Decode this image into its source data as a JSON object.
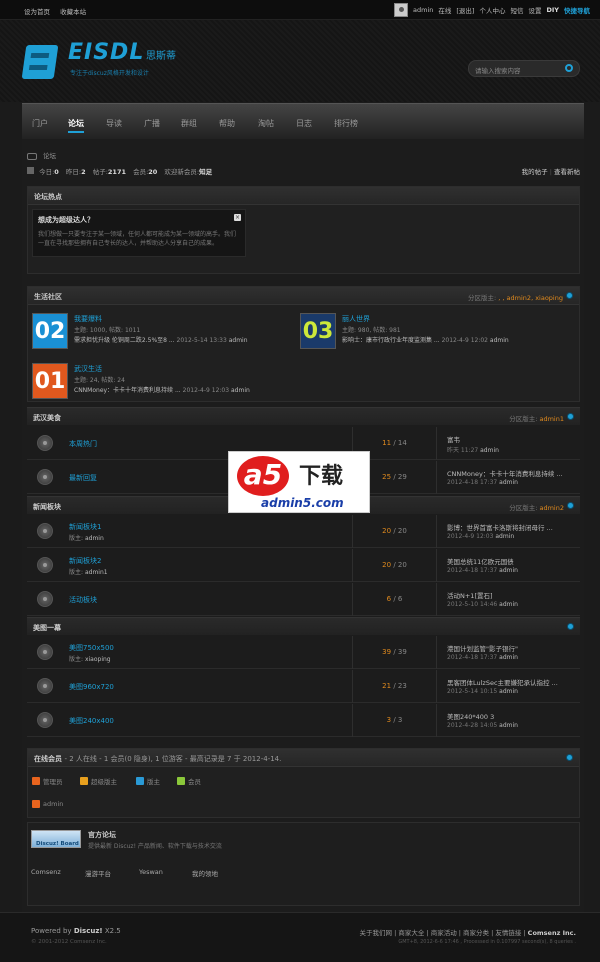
{
  "topbar": {
    "set_home": "设为首页",
    "favorite": "收藏本站",
    "username": "admin",
    "online": "在线",
    "logout": "[退出]",
    "personal": "个人中心",
    "messages": "短信",
    "settings": "设置",
    "diy": "DIY",
    "quick_nav": "快捷导航"
  },
  "header": {
    "logo_text": "EISDL",
    "logo_cn": "思斯蒂",
    "logo_sub": "专注于discuz风格开发和设计",
    "search_placeholder": "请输入搜索内容"
  },
  "nav": {
    "items": [
      "门户",
      "论坛",
      "导读",
      "广播",
      "群组",
      "帮助",
      "淘帖",
      "日志",
      "排行榜"
    ],
    "active": "论坛"
  },
  "breadcrumb": {
    "label": "论坛"
  },
  "stats": {
    "today_label": "今日:",
    "today": "0",
    "yesterday_label": "昨日:",
    "yesterday": "2",
    "posts_label": "帖子:",
    "posts": "2171",
    "members_label": "会员:",
    "members": "20",
    "newest_label": "欢迎新会员:",
    "newest": "知足",
    "my_posts": "我的帖子",
    "view_new": "查看新帖"
  },
  "hot": {
    "title": "论坛热点",
    "card_title": "想成为超级达人？",
    "card_text": "我们想做一只要专注于某一领域，任何人都可能成为某一领域的高手。我们一直在寻找那些拥有自己专长的达人，并帮助达人分享自己的成果。"
  },
  "life": {
    "title": "生活社区",
    "mod_label": "分区版主:",
    "mods": ", , admin2, xiaoping",
    "forums": [
      {
        "tile": "02",
        "name": "我要爆料",
        "meta": "主题: 1000, 帖数: 1011",
        "last": "需求担忧升级 伦铜周二跌2.5%至8 ...",
        "date": "2012-5-14 13:33",
        "user": "admin"
      },
      {
        "tile": "03",
        "name": "丽人世界",
        "meta": "主题: 980, 帖数: 981",
        "last": "影响士：康市行政行业年度监测集 ...",
        "date": "2012-4-9 12:02",
        "user": "admin"
      },
      {
        "tile": "01",
        "name": "武汉生活",
        "meta": "主题: 24, 帖数: 24",
        "last": "CNNMoney：卡卡十年消费利息持续 ...",
        "date": "2012-4-9 12:03",
        "user": "admin"
      }
    ]
  },
  "food": {
    "title": "武汉美食",
    "mod_label": "分区版主:",
    "mods": "admin1",
    "rows": [
      {
        "name": "本周热门",
        "meta": "",
        "threads": "11",
        "posts": "14",
        "last": "富韦",
        "date": "昨天 11:27",
        "user": "admin"
      },
      {
        "name": "最新回复",
        "meta": "",
        "threads": "25",
        "posts": "29",
        "last": "CNNMoney：卡卡十年消费利息持续 ...",
        "date": "2012-4-18 17:37",
        "user": "admin"
      }
    ]
  },
  "news": {
    "title": "新闻板块",
    "mod_label": "分区版主:",
    "mods": "admin2",
    "rows": [
      {
        "name": "新闻板块1",
        "meta_label": "版主:",
        "meta": "admin",
        "threads": "20",
        "posts": "20",
        "last": "影博：世界首富卡洛斯将封闭母行 ...",
        "date": "2012-4-9 12:03",
        "user": "admin"
      },
      {
        "name": "新闻板块2",
        "meta_label": "版主:",
        "meta": "admin1",
        "threads": "20",
        "posts": "20",
        "last": "美国总统11亿欧元国债",
        "date": "2012-4-18 17:37",
        "user": "admin"
      },
      {
        "name": "活动板块",
        "meta_label": "",
        "meta": "",
        "threads": "6",
        "posts": "6",
        "last": "活动N+1[置石]",
        "date": "2012-5-10 14:46",
        "user": "admin"
      }
    ]
  },
  "gallery": {
    "title": "美图一幕",
    "rows": [
      {
        "name": "美图750x500",
        "meta_label": "版主:",
        "meta": "xiaoping",
        "threads": "39",
        "posts": "39",
        "last": "港国计划监管\"影子银行\"",
        "date": "2012-4-18 17:37",
        "user": "admin"
      },
      {
        "name": "美图960x720",
        "meta_label": "",
        "meta": "",
        "threads": "21",
        "posts": "23",
        "last": "黑客团体LulzSec主要嫌犯承认指控 ...",
        "date": "2012-5-14 10:15",
        "user": "admin"
      },
      {
        "name": "美图240x400",
        "meta_label": "",
        "meta": "",
        "threads": "3",
        "posts": "3",
        "last": "美图240*400 3",
        "date": "2012-4-28 14:05",
        "user": "admin"
      }
    ]
  },
  "online": {
    "title": "在线会员",
    "summary": "- 2 人在线 - 1 会员(0 隐身), 1 位游客 - 最高记录是 7 于 2012-4-14.",
    "legend": [
      {
        "label": "管理员",
        "color": "#e8641e"
      },
      {
        "label": "超级版主",
        "color": "#e8a01e"
      },
      {
        "label": "版主",
        "color": "#2a9ad6"
      },
      {
        "label": "会员",
        "color": "#8bc83a"
      }
    ],
    "user": "admin"
  },
  "links": {
    "badge": "Discuz! Board",
    "official": "官方论坛",
    "official_desc": "提供最新 Discuz! 产品新闻、软件下载与技术交流",
    "items": [
      "Comsenz",
      "漫游平台",
      "Yeswan",
      "我的领地"
    ]
  },
  "footer": {
    "powered": "Powered by",
    "product": "Discuz!",
    "version": "X2.5",
    "copyright": "© 2001-2012 Comsenz Inc.",
    "links": [
      "关于我们网",
      "商家大全",
      "商家活动",
      "商家分类",
      "友情链接",
      "Comsenz Inc."
    ],
    "gmt": "GMT+8, 2012-6-6 17:46 , Processed in 0.107997 second(s), 8 queries ."
  },
  "watermark": {
    "a": "a5",
    "text": "下载",
    "url": "admin5.com"
  },
  "colors": {
    "accent": "#1fa0d6",
    "orange": "#e08a1e",
    "tile02": "#1a90d4",
    "tile03": "#1a3a6a",
    "tile01": "#e0581e"
  }
}
